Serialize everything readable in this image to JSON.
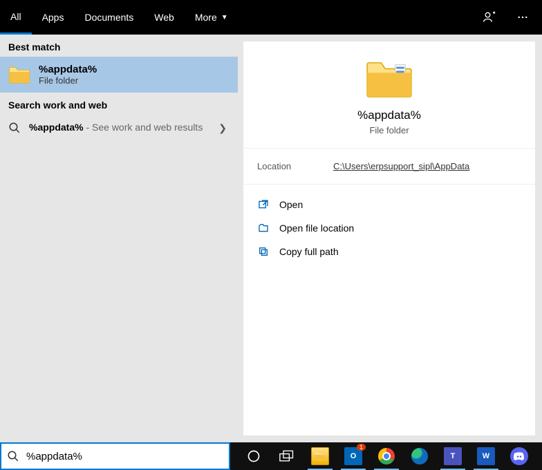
{
  "tabs": {
    "items": [
      "All",
      "Apps",
      "Documents",
      "Web",
      "More"
    ],
    "active_index": 0
  },
  "left": {
    "best_match_header": "Best match",
    "best_match": {
      "title": "%appdata%",
      "subtitle": "File folder"
    },
    "search_web_header": "Search work and web",
    "web_result": {
      "query": "%appdata%",
      "suffix": " - See work and web results"
    }
  },
  "preview": {
    "title": "%appdata%",
    "subtitle": "File folder",
    "location_label": "Location",
    "location_path": "C:\\Users\\erpsupport_sipl\\AppData",
    "actions": {
      "open": "Open",
      "open_location": "Open file location",
      "copy_path": "Copy full path"
    }
  },
  "search": {
    "value": "%appdata%"
  },
  "taskbar": {
    "outlook_badge": "1"
  }
}
